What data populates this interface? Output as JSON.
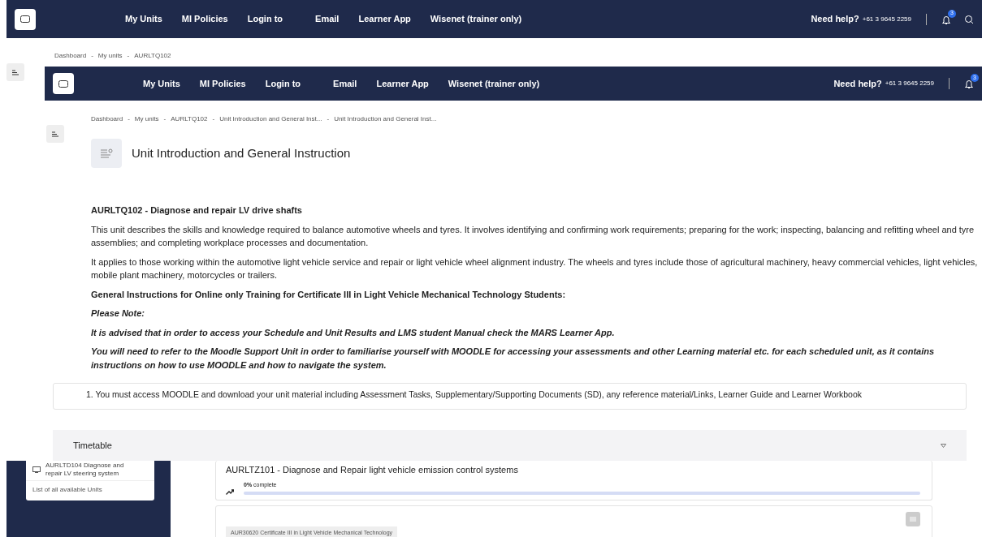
{
  "top_navbar": {
    "links": [
      "My Units",
      "MI Policies",
      "Login to",
      "Email",
      "Learner App",
      "Wisenet (trainer only)"
    ],
    "help_label": "Need help?",
    "phone": "+61 3 9645 2259",
    "notification_count": "3"
  },
  "breadcrumb": {
    "separator": "-",
    "items": [
      "Dashboard",
      "My units",
      "AURLTQ102"
    ]
  },
  "overlay_window": {
    "navbar": {
      "links": [
        "My Units",
        "MI Policies",
        "Login to",
        "Email",
        "Learner App",
        "Wisenet (trainer only)"
      ],
      "help_label": "Need help?",
      "phone": "+61 3 9645 2259",
      "notification_count": "3"
    },
    "breadcrumb": {
      "separator": "-",
      "items": [
        "Dashboard",
        "My units",
        "AURLTQ102",
        "Unit Introduction and General Inst...",
        "Unit Introduction and General Inst..."
      ]
    },
    "page_title": "Unit Introduction and General Instruction",
    "content": [
      {
        "kind": "heading",
        "text": "AURLTQ102 - Diagnose and repair LV drive shafts"
      },
      {
        "kind": "paragraph",
        "text": "This unit describes the skills and knowledge required to balance automotive wheels and tyres. It involves identifying and confirming work requirements; preparing for the work; inspecting, balancing and refitting wheel and tyre assemblies; and completing workplace processes and documentation."
      },
      {
        "kind": "paragraph",
        "text": "It applies to those working within the automotive light vehicle service and repair or light vehicle wheel alignment industry. The wheels and tyres include those of agricultural machinery, heavy commercial vehicles, light vehicles, mobile plant machinery, motorcycles or trailers."
      },
      {
        "kind": "heading",
        "text": "General Instructions for Online only Training for Certificate III in Light Vehicle Mechanical Technology Students:"
      },
      {
        "kind": "note",
        "text": "Please Note:"
      },
      {
        "kind": "note",
        "text": "It is advised that in order to access your Schedule and Unit Results and LMS student Manual check the MARS Learner App."
      },
      {
        "kind": "note",
        "text": "You will need to refer to the Moodle Support Unit in order to familiarise yourself with MOODLE for accessing your assessments and other Learning material etc. for each scheduled unit, as it contains instructions on how to use MOODLE and how to navigate the system."
      }
    ]
  },
  "instruction_line": "1. You must access MOODLE and download your unit material including Assessment Tasks, Supplementary/Supporting Documents (SD), any reference material/Links, Learner Guide and Learner Workbook",
  "timetable": {
    "label": "Timetable"
  },
  "sidebar": {
    "units": [
      {
        "name": "AURLTD104 Diagnose and repair LV steering system"
      }
    ],
    "footer_link": "List of all available Units"
  },
  "courses": [
    {
      "title": "AURLTZ101 - Diagnose and Repair light vehicle emission control systems",
      "progress_label": "**0%** complete",
      "level": 0
    }
  ],
  "qualification_tag": "AUR30620 Certificate III in Light Vehicle Mechanical Technology"
}
